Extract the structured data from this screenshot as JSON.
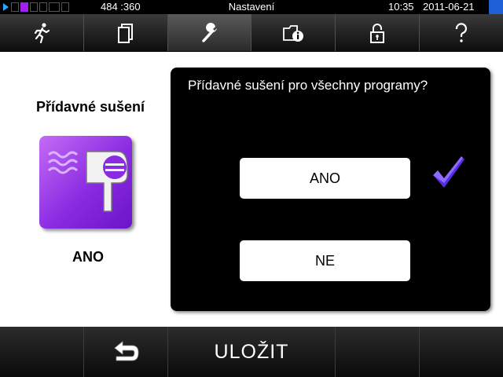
{
  "status_bar": {
    "coordinates": "484 :360",
    "title": "Nastavení",
    "time": "10:35",
    "date": "2011-06-21",
    "icons": [
      "play-icon",
      "card-icon",
      "mail-icon",
      "keyboard-icon",
      "lock-icon",
      "grid-icon",
      "flag-icon"
    ]
  },
  "tabs": [
    {
      "icon": "running-man-icon"
    },
    {
      "icon": "documents-icon"
    },
    {
      "icon": "wrench-icon",
      "active": true
    },
    {
      "icon": "folder-info-icon"
    },
    {
      "icon": "unlocked-padlock-icon"
    },
    {
      "icon": "question-mark-icon"
    }
  ],
  "left_panel": {
    "title": "Přídavné sušení",
    "icon": "hair-dryer-icon",
    "value": "ANO",
    "tile_color": "#8a2be2"
  },
  "dialog": {
    "question": "Přídavné sušení pro všechny programy?",
    "options": [
      {
        "label": "ANO",
        "selected": true
      },
      {
        "label": "NE",
        "selected": false
      }
    ],
    "check_icon": "checkmark-icon",
    "check_color": "#5a2de0"
  },
  "bottom_bar": {
    "back_icon": "back-arrow-icon",
    "save_label": "ULOŽIT"
  }
}
